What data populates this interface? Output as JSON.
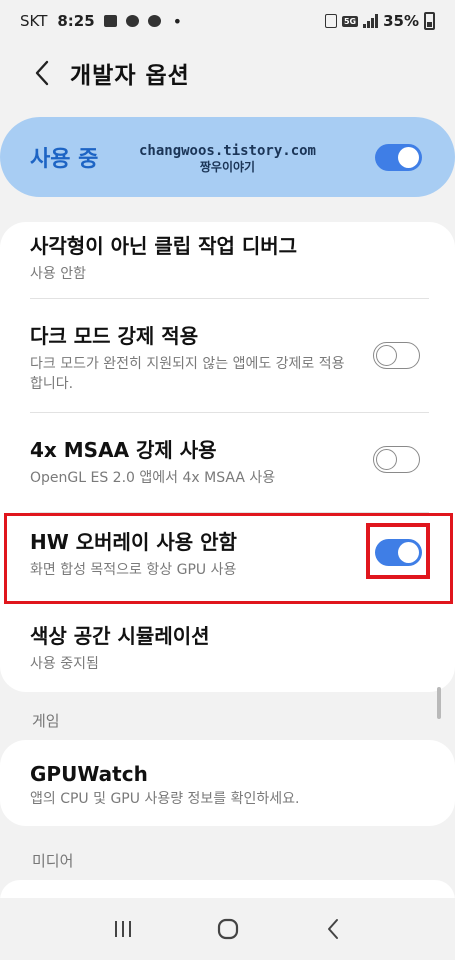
{
  "status_bar": {
    "carrier": "SKT",
    "time": "8:25",
    "battery": "35%",
    "network_badge": "5G"
  },
  "header": {
    "title": "개발자 옵션"
  },
  "master_switch": {
    "label": "사용 중",
    "on": true
  },
  "watermark": {
    "line1": "changwoos.tistory.com",
    "line2": "짱우이야기"
  },
  "settings": [
    {
      "title": "사각형이 아닌 클립 작업 디버그",
      "subtitle": "사용 안함"
    },
    {
      "title": "다크 모드 강제 적용",
      "subtitle": "다크 모드가 완전히 지원되지 않는 앱에도 강제로 적용합니다.",
      "toggle": false
    },
    {
      "title": "4x MSAA 강제 사용",
      "subtitle": "OpenGL ES 2.0 앱에서 4x MSAA 사용",
      "toggle": false
    },
    {
      "title": "HW 오버레이 사용 안함",
      "subtitle": "화면 합성 목적으로 항상 GPU 사용",
      "toggle": true
    },
    {
      "title": "색상 공간 시뮬레이션",
      "subtitle": "사용 중지됨"
    }
  ],
  "sections": {
    "game": {
      "label": "게임",
      "items": [
        {
          "title": "GPUWatch",
          "subtitle": "앱의 CPU 및 GPU 사용량 정보를 확인하세요."
        }
      ]
    },
    "media": {
      "label": "미디어"
    }
  },
  "colors": {
    "accent": "#3f7ee6",
    "master_bg": "#a8cdf3",
    "master_text": "#1d64c4",
    "highlight": "#e0161d",
    "background": "#f2f2f2"
  },
  "icons": {
    "back": "chevron-left-icon",
    "nav_recents": "recents-icon",
    "nav_home": "home-icon",
    "nav_back": "back-icon"
  }
}
